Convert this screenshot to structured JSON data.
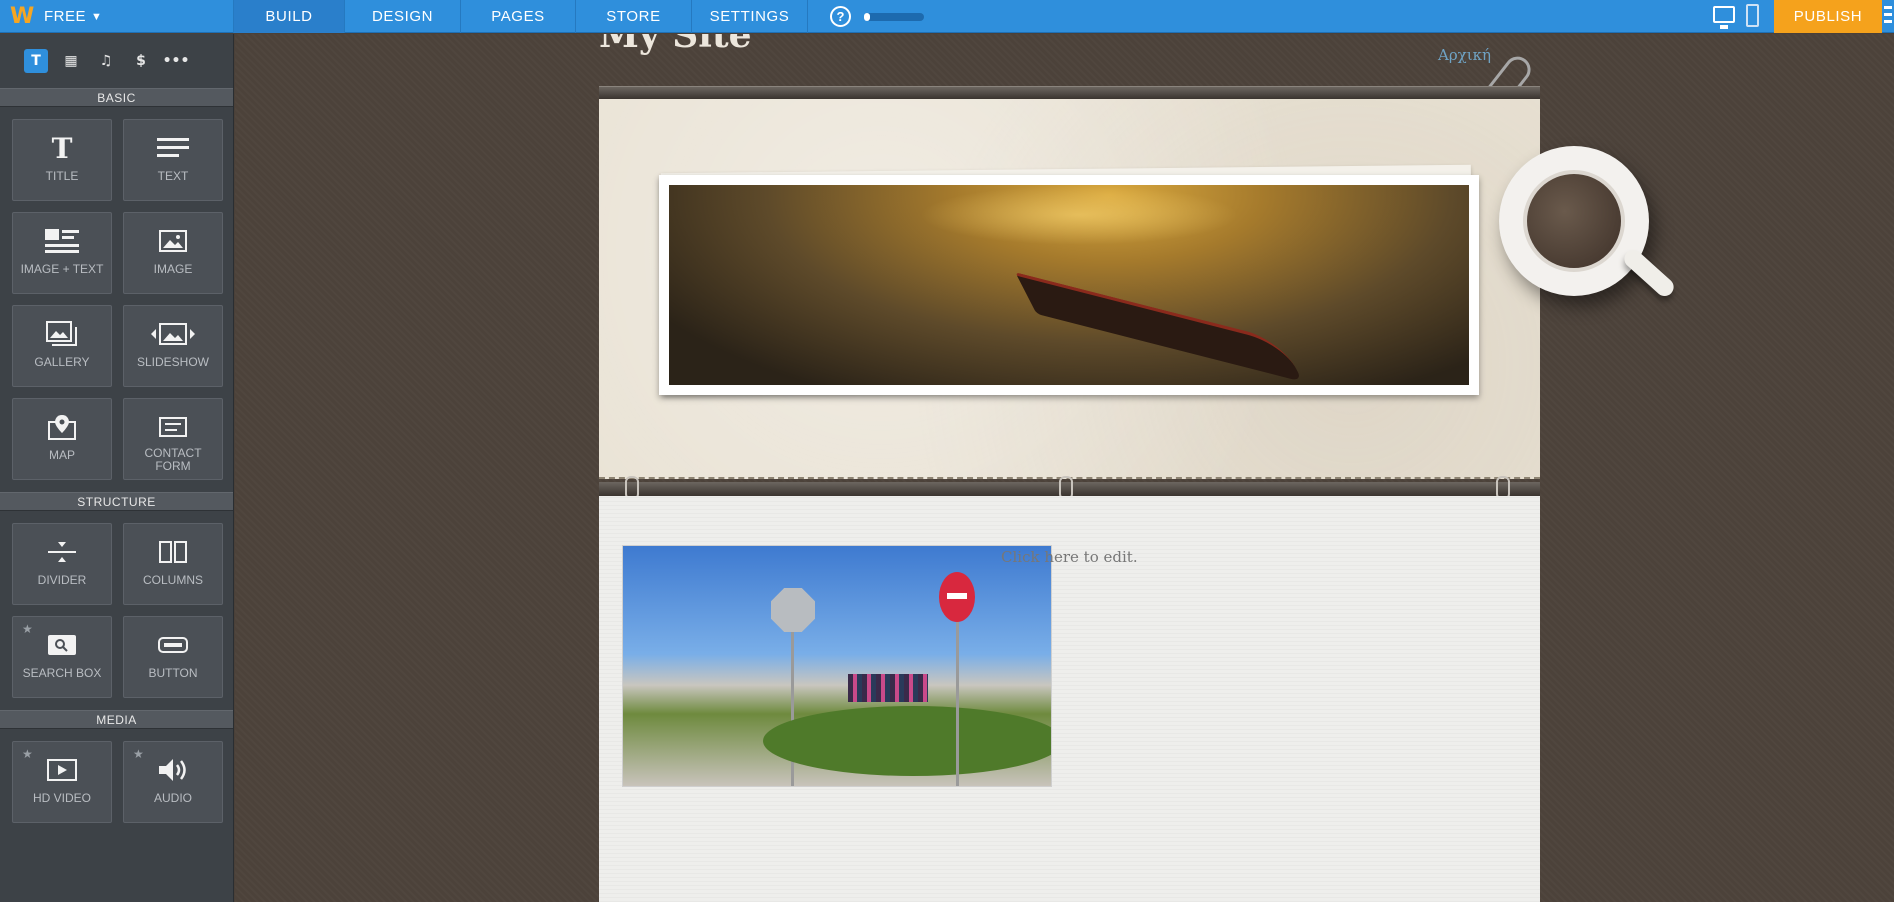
{
  "topbar": {
    "plan": "FREE",
    "tabs": [
      {
        "label": "BUILD"
      },
      {
        "label": "DESIGN"
      },
      {
        "label": "PAGES"
      },
      {
        "label": "STORE"
      },
      {
        "label": "SETTINGS"
      }
    ],
    "publish_label": "PUBLISH",
    "progress_percent": 10
  },
  "sidebar": {
    "tools": [
      "T",
      "▦",
      "♫",
      "$",
      "•••"
    ],
    "sections": {
      "basic": "BASIC",
      "structure": "STRUCTURE",
      "media": "MEDIA"
    },
    "basic_items": [
      {
        "label": "TITLE"
      },
      {
        "label": "TEXT"
      },
      {
        "label": "IMAGE + TEXT"
      },
      {
        "label": "IMAGE"
      },
      {
        "label": "GALLERY"
      },
      {
        "label": "SLIDESHOW"
      },
      {
        "label": "MAP"
      },
      {
        "label": "CONTACT FORM"
      }
    ],
    "structure_items": [
      {
        "label": "DIVIDER"
      },
      {
        "label": "COLUMNS"
      },
      {
        "label": "SEARCH BOX"
      },
      {
        "label": "BUTTON"
      }
    ],
    "media_items": [
      {
        "label": "HD VIDEO"
      },
      {
        "label": "AUDIO"
      }
    ]
  },
  "site": {
    "title": "My Site",
    "nav_link": "Αρχική",
    "edit_placeholder": "Click here to edit."
  },
  "colors": {
    "accent": "#2f8fdc",
    "publish": "#f5a21c",
    "sidebar": "#3d4247"
  }
}
